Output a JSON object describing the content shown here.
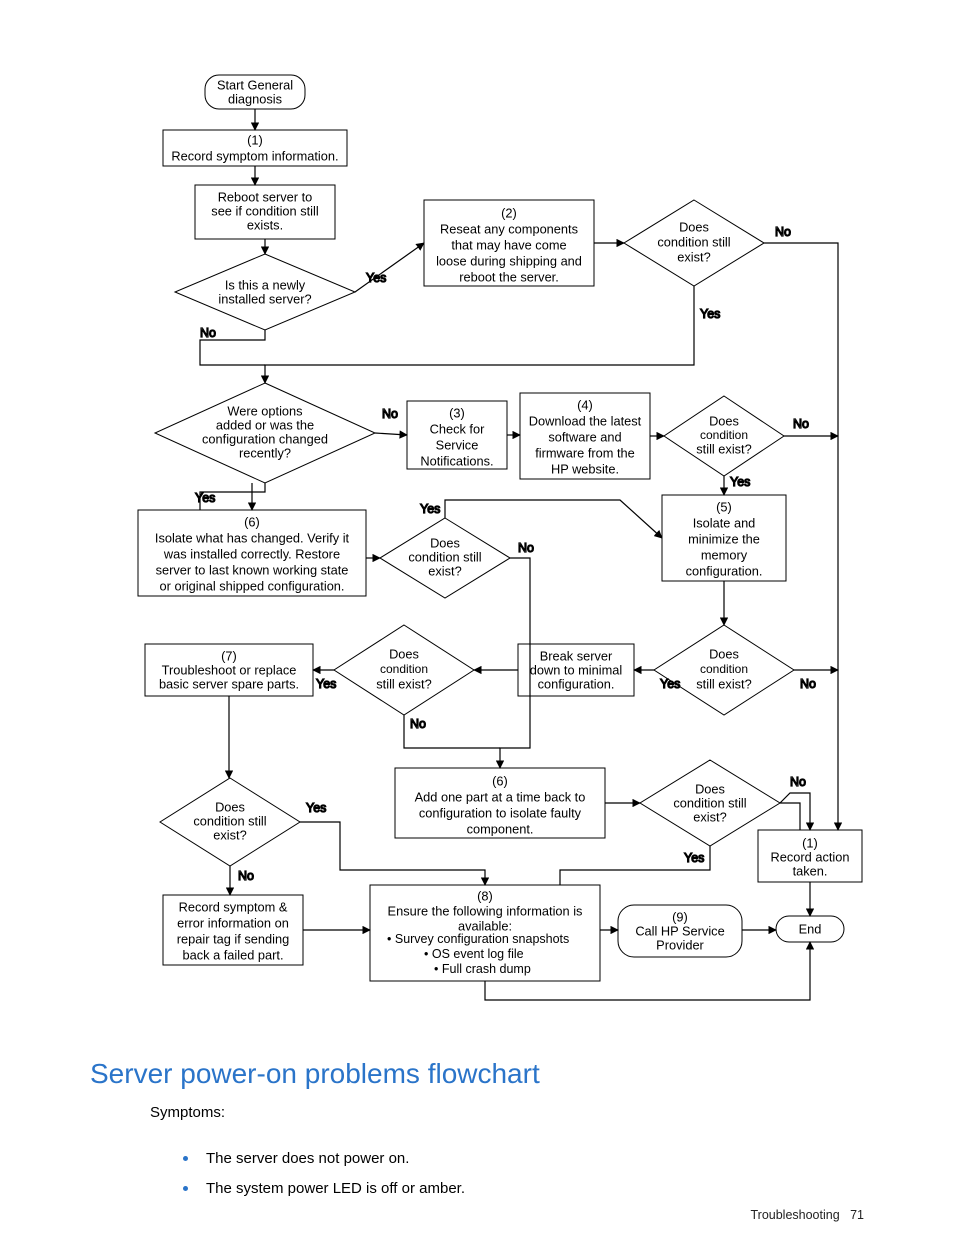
{
  "chart_data": {
    "type": "flowchart",
    "title": "General diagnosis flowchart",
    "nodes": [
      {
        "id": "start",
        "kind": "terminator",
        "text": "Start General diagnosis"
      },
      {
        "id": "n1",
        "kind": "process",
        "text": "(1)\nRecord symptom information."
      },
      {
        "id": "nReboot",
        "kind": "process",
        "text": "Reboot server to see if condition still exists."
      },
      {
        "id": "dNew",
        "kind": "decision",
        "text": "Is this a newly installed server?"
      },
      {
        "id": "n2",
        "kind": "process",
        "text": "(2)\nReseat any components that may have come loose during shipping and reboot the server."
      },
      {
        "id": "dCond2",
        "kind": "decision",
        "text": "Does condition still exist?"
      },
      {
        "id": "dOpts",
        "kind": "decision",
        "text": "Were options added or was the configuration changed recently?"
      },
      {
        "id": "n3",
        "kind": "process",
        "text": "(3)\nCheck for Service Notifications."
      },
      {
        "id": "n4",
        "kind": "process",
        "text": "(4)\nDownload the latest software and firmware from the HP website."
      },
      {
        "id": "dCond4",
        "kind": "decision",
        "text": "Does condition still exist?"
      },
      {
        "id": "n5",
        "kind": "process",
        "text": "(5)\nIsolate and minimize the memory configuration."
      },
      {
        "id": "n6iso",
        "kind": "process",
        "text": "(6)\nIsolate what has changed. Verify it was installed correctly.  Restore server to last known working state or original shipped configuration."
      },
      {
        "id": "dCond6",
        "kind": "decision",
        "text": "Does condition still exist?"
      },
      {
        "id": "nBreak",
        "kind": "process",
        "text": "Break server down to minimal configuration."
      },
      {
        "id": "dCond5",
        "kind": "decision",
        "text": "Does condition still exist?"
      },
      {
        "id": "dCondBreak",
        "kind": "decision",
        "text": "Does condition still exist?"
      },
      {
        "id": "n7",
        "kind": "process",
        "text": "(7)\nTroubleshoot or replace basic server spare parts."
      },
      {
        "id": "n6add",
        "kind": "process",
        "text": "(6)\nAdd one part at a time back to configuration to isolate faulty component."
      },
      {
        "id": "dCondAdd",
        "kind": "decision",
        "text": "Does condition still exist?"
      },
      {
        "id": "dCond7",
        "kind": "decision",
        "text": "Does condition still exist?"
      },
      {
        "id": "nRecordTag",
        "kind": "process",
        "text": "Record symptom & error information on repair tag if sending back a failed part."
      },
      {
        "id": "n8",
        "kind": "process",
        "text": "(8)\nEnsure the following information is available:\n• Survey configuration snapshots\n• OS event log file\n• Full crash dump"
      },
      {
        "id": "n9",
        "kind": "terminator",
        "text": "(9)\nCall HP Service Provider"
      },
      {
        "id": "n1rec",
        "kind": "process",
        "text": "(1)\nRecord action taken."
      },
      {
        "id": "end",
        "kind": "terminator",
        "text": "End"
      }
    ],
    "edges": [
      {
        "from": "start",
        "to": "n1"
      },
      {
        "from": "n1",
        "to": "nReboot"
      },
      {
        "from": "nReboot",
        "to": "dNew"
      },
      {
        "from": "dNew",
        "to": "n2",
        "label": "Yes"
      },
      {
        "from": "n2",
        "to": "dCond2"
      },
      {
        "from": "dCond2",
        "to": "n1rec",
        "label": "No"
      },
      {
        "from": "dCond2",
        "to": "dOpts",
        "label": "Yes"
      },
      {
        "from": "dNew",
        "to": "dOpts",
        "label": "No"
      },
      {
        "from": "dOpts",
        "to": "n6iso",
        "label": "Yes"
      },
      {
        "from": "dOpts",
        "to": "n3",
        "label": "No"
      },
      {
        "from": "n3",
        "to": "n4"
      },
      {
        "from": "n4",
        "to": "dCond4"
      },
      {
        "from": "dCond4",
        "to": "n5",
        "label": "Yes"
      },
      {
        "from": "dCond4",
        "to": "n1rec",
        "label": "No"
      },
      {
        "from": "n6iso",
        "to": "dCond6"
      },
      {
        "from": "dCond6",
        "to": "n5",
        "label": "Yes"
      },
      {
        "from": "dCond6",
        "to": "n6add",
        "label": "No"
      },
      {
        "from": "n5",
        "to": "dCond5"
      },
      {
        "from": "dCond5",
        "to": "nBreak",
        "label": "Yes"
      },
      {
        "from": "dCond5",
        "to": "n1rec",
        "label": "No"
      },
      {
        "from": "nBreak",
        "to": "dCondBreak"
      },
      {
        "from": "dCondBreak",
        "to": "n7",
        "label": "Yes"
      },
      {
        "from": "dCondBreak",
        "to": "n6add",
        "label": "No"
      },
      {
        "from": "n7",
        "to": "dCond7"
      },
      {
        "from": "dCond7",
        "to": "n8",
        "label": "Yes"
      },
      {
        "from": "dCond7",
        "to": "nRecordTag",
        "label": "No"
      },
      {
        "from": "n6add",
        "to": "dCondAdd"
      },
      {
        "from": "dCondAdd",
        "to": "n8",
        "label": "Yes"
      },
      {
        "from": "dCondAdd",
        "to": "n1rec",
        "label": "No"
      },
      {
        "from": "nRecordTag",
        "to": "n8"
      },
      {
        "from": "n8",
        "to": "n9"
      },
      {
        "from": "n9",
        "to": "end"
      },
      {
        "from": "n1rec",
        "to": "end"
      }
    ]
  },
  "heading": "Server power-on problems flowchart",
  "symptoms_label": "Symptoms:",
  "symptoms": [
    "The server does not power on.",
    "The system power LED is off or amber."
  ],
  "footer_section": "Troubleshooting",
  "footer_page": "71",
  "labels": {
    "yes": "Yes",
    "no": "No"
  },
  "node_text": {
    "start1": "Start General",
    "start2": "diagnosis",
    "n1_a": "(1)",
    "n1_b": "Record symptom information.",
    "reboot1": "Reboot server to",
    "reboot2": "see if condition still",
    "reboot3": "exists.",
    "dNew1": "Is this a newly",
    "dNew2": "installed server?",
    "n2_a": "(2)",
    "n2_b": "Reseat any components",
    "n2_c": "that may have come",
    "n2_d": "loose during shipping and",
    "n2_e": "reboot the server.",
    "cond1": "Does",
    "cond2": "condition still",
    "cond3": "exist?",
    "cond3b": "still exist?",
    "dOpts1": "Were options",
    "dOpts2": "added or was the",
    "dOpts3": "configuration changed",
    "dOpts4": "recently?",
    "n3_a": "(3)",
    "n3_b": "Check for",
    "n3_c": "Service",
    "n3_d": "Notifications.",
    "n4_a": "(4)",
    "n4_b": "Download the latest",
    "n4_c": "software and",
    "n4_d": "firmware from the",
    "n4_e": "HP website.",
    "n5_a": "(5)",
    "n5_b": "Isolate and",
    "n5_c": "minimize the",
    "n5_d": "memory",
    "n5_e": "configuration.",
    "n6iso_a": "(6)",
    "n6iso_b": "Isolate what has changed. Verify it",
    "n6iso_c": "was installed correctly.  Restore",
    "n6iso_d": "server to last known working state",
    "n6iso_e": "or original shipped configuration.",
    "n7_a": "(7)",
    "n7_b": "Troubleshoot or replace",
    "n7_c": "basic server spare parts.",
    "nBreak1": "Break server",
    "nBreak2": "down to minimal",
    "nBreak3": "configuration.",
    "n6add_a": "(6)",
    "n6add_b": "Add one part at a time back to",
    "n6add_c": "configuration to isolate faulty",
    "n6add_d": "component.",
    "recTag1": "Record symptom &",
    "recTag2": "error information on",
    "recTag3": "repair tag if sending",
    "recTag4": "back a failed part.",
    "n8_a": "(8)",
    "n8_b": "Ensure the following information is",
    "n8_c": "available:",
    "n8_d": "Survey configuration snapshots",
    "n8_e": "OS event log file",
    "n8_f": "Full crash dump",
    "n9_a": "(9)",
    "n9_b": "Call HP Service",
    "n9_c": "Provider",
    "n1rec_a": "(1)",
    "n1rec_b": "Record action",
    "n1rec_c": "taken.",
    "end": "End"
  }
}
